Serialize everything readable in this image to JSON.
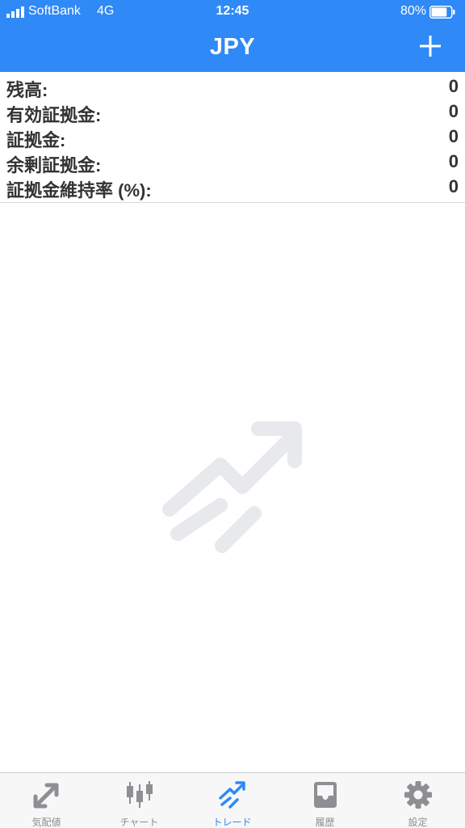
{
  "status_bar": {
    "carrier": "SoftBank",
    "network": "4G",
    "time": "12:45",
    "battery_percent": "80%",
    "battery_level": 0.8
  },
  "nav": {
    "title": "JPY",
    "add_icon": "plus-icon"
  },
  "account": {
    "rows": [
      {
        "label": "残高:",
        "value": "0"
      },
      {
        "label": "有効証拠金:",
        "value": "0"
      },
      {
        "label": "証拠金:",
        "value": "0"
      },
      {
        "label": "余剰証拠金:",
        "value": "0"
      },
      {
        "label": "証拠金維持率 (%):",
        "value": "0"
      }
    ]
  },
  "empty_state": {
    "icon": "trade-trend-icon"
  },
  "tabs": [
    {
      "label": "気配値",
      "icon": "quotes-icon",
      "active": false
    },
    {
      "label": "チャート",
      "icon": "candlestick-icon",
      "active": false
    },
    {
      "label": "トレード",
      "icon": "trade-icon",
      "active": true
    },
    {
      "label": "履歴",
      "icon": "inbox-icon",
      "active": false
    },
    {
      "label": "設定",
      "icon": "gear-icon",
      "active": false
    }
  ],
  "colors": {
    "accent": "#2f89f6",
    "tab_inactive": "#8e8e93",
    "placeholder_icon": "#e8e9ec"
  }
}
